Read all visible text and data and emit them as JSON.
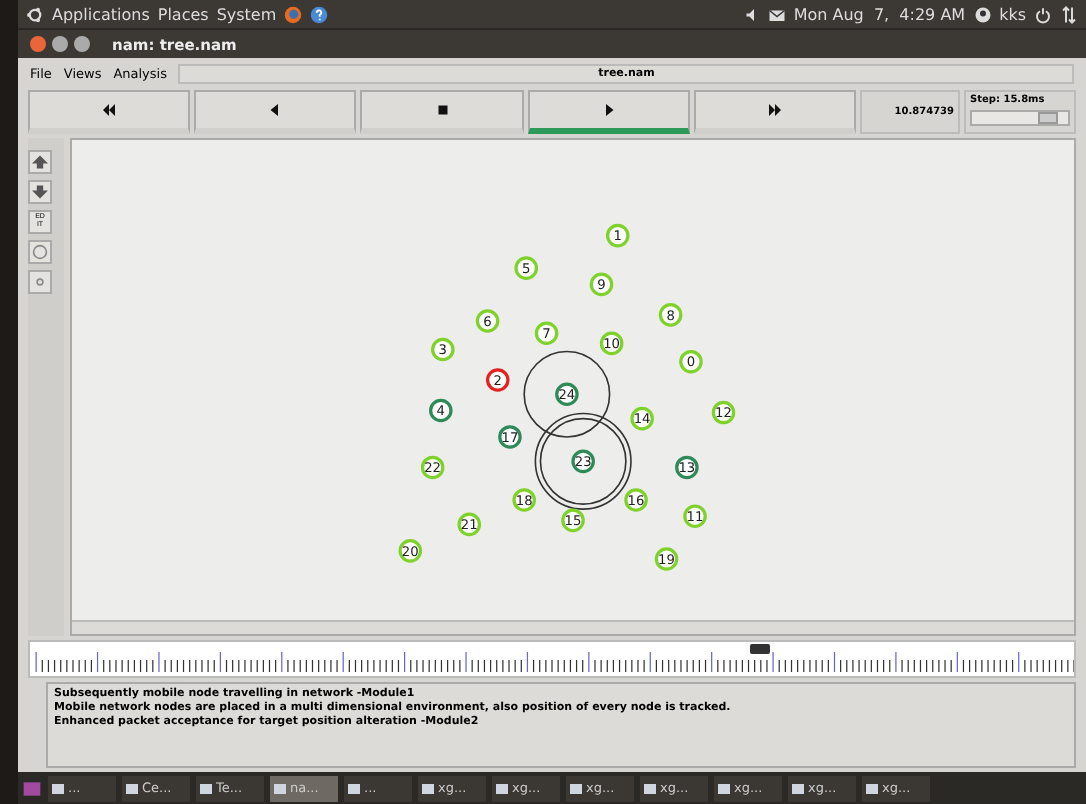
{
  "top_panel": {
    "menus": [
      "Applications",
      "Places",
      "System"
    ],
    "clock": "Mon Aug  7,  4:29 AM",
    "user": "kks"
  },
  "window": {
    "title": "nam: tree.nam"
  },
  "menu": [
    "File",
    "Views",
    "Analysis"
  ],
  "file_label": "tree.nam",
  "controls": [
    {
      "kind": "rewind",
      "selected": false
    },
    {
      "kind": "back",
      "selected": false
    },
    {
      "kind": "stop",
      "selected": false
    },
    {
      "kind": "play",
      "selected": true
    },
    {
      "kind": "forward",
      "selected": false
    }
  ],
  "time": "10.874739",
  "step": {
    "label": "Step: 15.8ms",
    "level": 0.8
  },
  "tools": [
    {
      "kind": "zoom-in"
    },
    {
      "kind": "zoom-out"
    },
    {
      "kind": "edit",
      "label": "ED IT"
    },
    {
      "kind": "circle"
    },
    {
      "kind": "dot"
    }
  ],
  "nodes": [
    {
      "label": "1",
      "color": "#7fd12b",
      "kind": "plain"
    },
    {
      "label": "5",
      "color": "#7fd12b",
      "kind": "plain"
    },
    {
      "label": "9",
      "color": "#7fd12b",
      "kind": "plain"
    },
    {
      "label": "6",
      "color": "#7fd12b",
      "kind": "plain"
    },
    {
      "label": "8",
      "color": "#7fd12b",
      "kind": "plain"
    },
    {
      "label": "7",
      "color": "#7fd12b",
      "kind": "plain"
    },
    {
      "label": "10",
      "color": "#7fd12b",
      "kind": "plain"
    },
    {
      "label": "3",
      "color": "#7fd12b",
      "kind": "plain"
    },
    {
      "label": "0",
      "color": "#7fd12b",
      "kind": "plain"
    },
    {
      "label": "2",
      "color": "#e52222",
      "kind": "plain"
    },
    {
      "label": "24",
      "color": "#2e8b57",
      "kind": "ring"
    },
    {
      "label": "4",
      "color": "#2e8b57",
      "kind": "plain"
    },
    {
      "label": "14",
      "color": "#7fd12b",
      "kind": "plain"
    },
    {
      "label": "12",
      "color": "#7fd12b",
      "kind": "plain"
    },
    {
      "label": "17",
      "color": "#2e8b57",
      "kind": "plain"
    },
    {
      "label": "23",
      "color": "#2e8b57",
      "kind": "double-ring"
    },
    {
      "label": "22",
      "color": "#7fd12b",
      "kind": "plain"
    },
    {
      "label": "13",
      "color": "#2e8b57",
      "kind": "plain"
    },
    {
      "label": "21",
      "color": "#7fd12b",
      "kind": "plain"
    },
    {
      "label": "18",
      "color": "#7fd12b",
      "kind": "plain"
    },
    {
      "label": "15",
      "color": "#7fd12b",
      "kind": "plain"
    },
    {
      "label": "16",
      "color": "#7fd12b",
      "kind": "plain"
    },
    {
      "label": "11",
      "color": "#7fd12b",
      "kind": "plain"
    },
    {
      "label": "20",
      "color": "#7fd12b",
      "kind": "plain"
    },
    {
      "label": "19",
      "color": "#7fd12b",
      "kind": "plain"
    }
  ],
  "timeline": {
    "level": 0.69
  },
  "messages": [
    "Subsequently mobile node travelling in network -Module1",
    "Mobile network nodes are placed in a multi dimensional environment, also position of every node is tracked.",
    "Enhanced packet acceptance for target position alteration -Module2"
  ],
  "taskbar": [
    {
      "label": "...",
      "selected": false
    },
    {
      "label": "Ce...",
      "selected": false
    },
    {
      "label": "Te...",
      "selected": false
    },
    {
      "label": "na...",
      "selected": true
    },
    {
      "label": "...",
      "selected": false
    },
    {
      "label": "xg...",
      "selected": false
    },
    {
      "label": "xg...",
      "selected": false
    },
    {
      "label": "xg...",
      "selected": false
    },
    {
      "label": "xg...",
      "selected": false
    },
    {
      "label": "xg...",
      "selected": false
    },
    {
      "label": "xg...",
      "selected": false
    },
    {
      "label": "xg...",
      "selected": false
    }
  ]
}
